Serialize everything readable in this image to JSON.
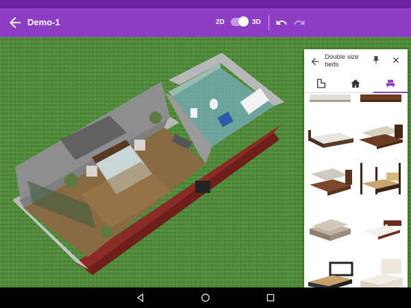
{
  "app": {
    "title": "Demo-1",
    "mode_2d": "2D",
    "mode_3d": "3D",
    "mode_selected": "3D",
    "accent": "#8e3ec5"
  },
  "toolbar": {
    "back_icon": "arrow-left-icon",
    "undo_icon": "undo-icon",
    "redo_icon": "redo-icon"
  },
  "panel": {
    "title": "Double size beds",
    "back_icon": "arrow-left-icon",
    "pin_icon": "pin-icon",
    "close_icon": "close-icon",
    "tabs": [
      {
        "icon": "room-shape-icon",
        "active": false
      },
      {
        "icon": "home-icon",
        "active": false
      },
      {
        "icon": "bed-icon",
        "active": true
      }
    ],
    "items": [
      {
        "name": "bed-item-1"
      },
      {
        "name": "bed-item-2"
      },
      {
        "name": "bed-item-3"
      },
      {
        "name": "bed-item-4"
      },
      {
        "name": "bed-item-5"
      },
      {
        "name": "bed-item-6"
      },
      {
        "name": "bed-item-7"
      },
      {
        "name": "bed-item-8"
      },
      {
        "name": "bed-item-9"
      },
      {
        "name": "bed-item-10"
      }
    ]
  },
  "navbar": {
    "back_icon": "nav-back-icon",
    "home_icon": "nav-home-icon",
    "recents_icon": "nav-recents-icon"
  }
}
